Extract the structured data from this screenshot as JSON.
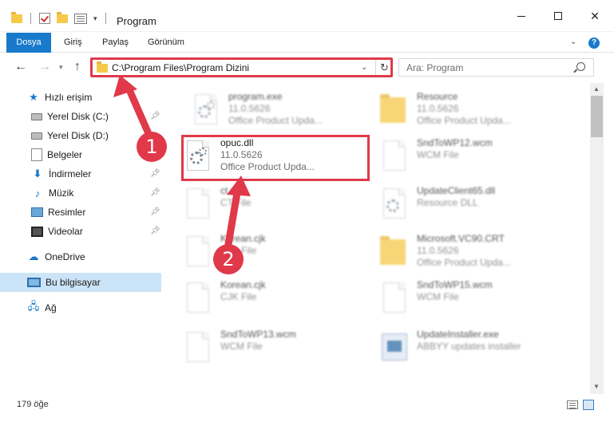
{
  "window": {
    "title": "Program",
    "minimize_label": "",
    "close_label": "✕"
  },
  "ribbon": {
    "tabs": [
      {
        "label": "Dosya"
      },
      {
        "label": "Giriş"
      },
      {
        "label": "Paylaş"
      },
      {
        "label": "Görünüm"
      }
    ],
    "help_label": "?"
  },
  "navigation": {
    "back": "←",
    "forward": "→",
    "recent": "▾",
    "up": "↑",
    "address": "C:\\Program Files\\Program Dizini",
    "refresh": "↻",
    "search_placeholder": "Ara: Program"
  },
  "sidebar": {
    "items": [
      {
        "label": "Hızlı erişim",
        "pinned": false
      },
      {
        "label": "Yerel Disk (C:)",
        "pinned": true
      },
      {
        "label": "Yerel Disk (D:)",
        "pinned": false
      },
      {
        "label": "Belgeler",
        "pinned": false
      },
      {
        "label": "İndirmeler",
        "pinned": true
      },
      {
        "label": "Müzik",
        "pinned": true
      },
      {
        "label": "Resimler",
        "pinned": true
      },
      {
        "label": "Videolar",
        "pinned": true
      },
      {
        "label": "OneDrive",
        "pinned": false
      },
      {
        "label": "Bu bilgisayar",
        "pinned": false,
        "selected": true
      },
      {
        "label": "Ağ",
        "pinned": false
      }
    ]
  },
  "files": {
    "left_column": [
      {
        "name": "program.exe",
        "line1": "11.0.5626",
        "line2": "Office Product Upda...",
        "icon": "gear-file-icon",
        "blurred": true
      },
      {
        "name": "opuc.dll",
        "line1": "11.0.5626",
        "line2": "Office Product Upda...",
        "icon": "dll-file-icon",
        "blurred": false,
        "highlighted": true
      },
      {
        "name": "ct.nls",
        "line1": "CT File",
        "line2": "",
        "icon": "file-icon",
        "blurred": true
      },
      {
        "name": "Korean.cjk",
        "line1": "CJK File",
        "line2": "",
        "icon": "file-icon",
        "blurred": true
      },
      {
        "name": "Korean.cjk",
        "line1": "CJK File",
        "line2": "",
        "icon": "file-icon",
        "blurred": true
      },
      {
        "name": "SndToWP13.wcm",
        "line1": "WCM File",
        "line2": "",
        "icon": "file-icon",
        "blurred": true
      }
    ],
    "right_column": [
      {
        "name": "Resource",
        "line1": "11.0.5626",
        "line2": "Office Product Upda...",
        "icon": "folder-icon",
        "blurred": true
      },
      {
        "name": "SndToWP12.wcm",
        "line1": "WCM File",
        "line2": "",
        "icon": "file-icon",
        "blurred": true
      },
      {
        "name": "UpdateClient65.dll",
        "line1": "Resource DLL",
        "line2": "",
        "icon": "dll-file-icon",
        "blurred": true
      },
      {
        "name": "Microsoft.VC90.CRT",
        "line1": "11.0.5626",
        "line2": "Office Product Upda...",
        "icon": "folder-icon",
        "blurred": true
      },
      {
        "name": "SndToWP15.wcm",
        "line1": "WCM File",
        "line2": "",
        "icon": "file-icon",
        "blurred": true
      },
      {
        "name": "UpdateInstaller.exe",
        "line1": "ABBYY updates installer",
        "line2": "",
        "icon": "exe-icon",
        "blurred": true
      }
    ]
  },
  "status": {
    "item_count": "179 öğe"
  },
  "annotations": {
    "step1": "1",
    "step2": "2",
    "color": "#e0394a"
  },
  "colors": {
    "accent": "#1979ca",
    "selection": "#cce4f7"
  }
}
